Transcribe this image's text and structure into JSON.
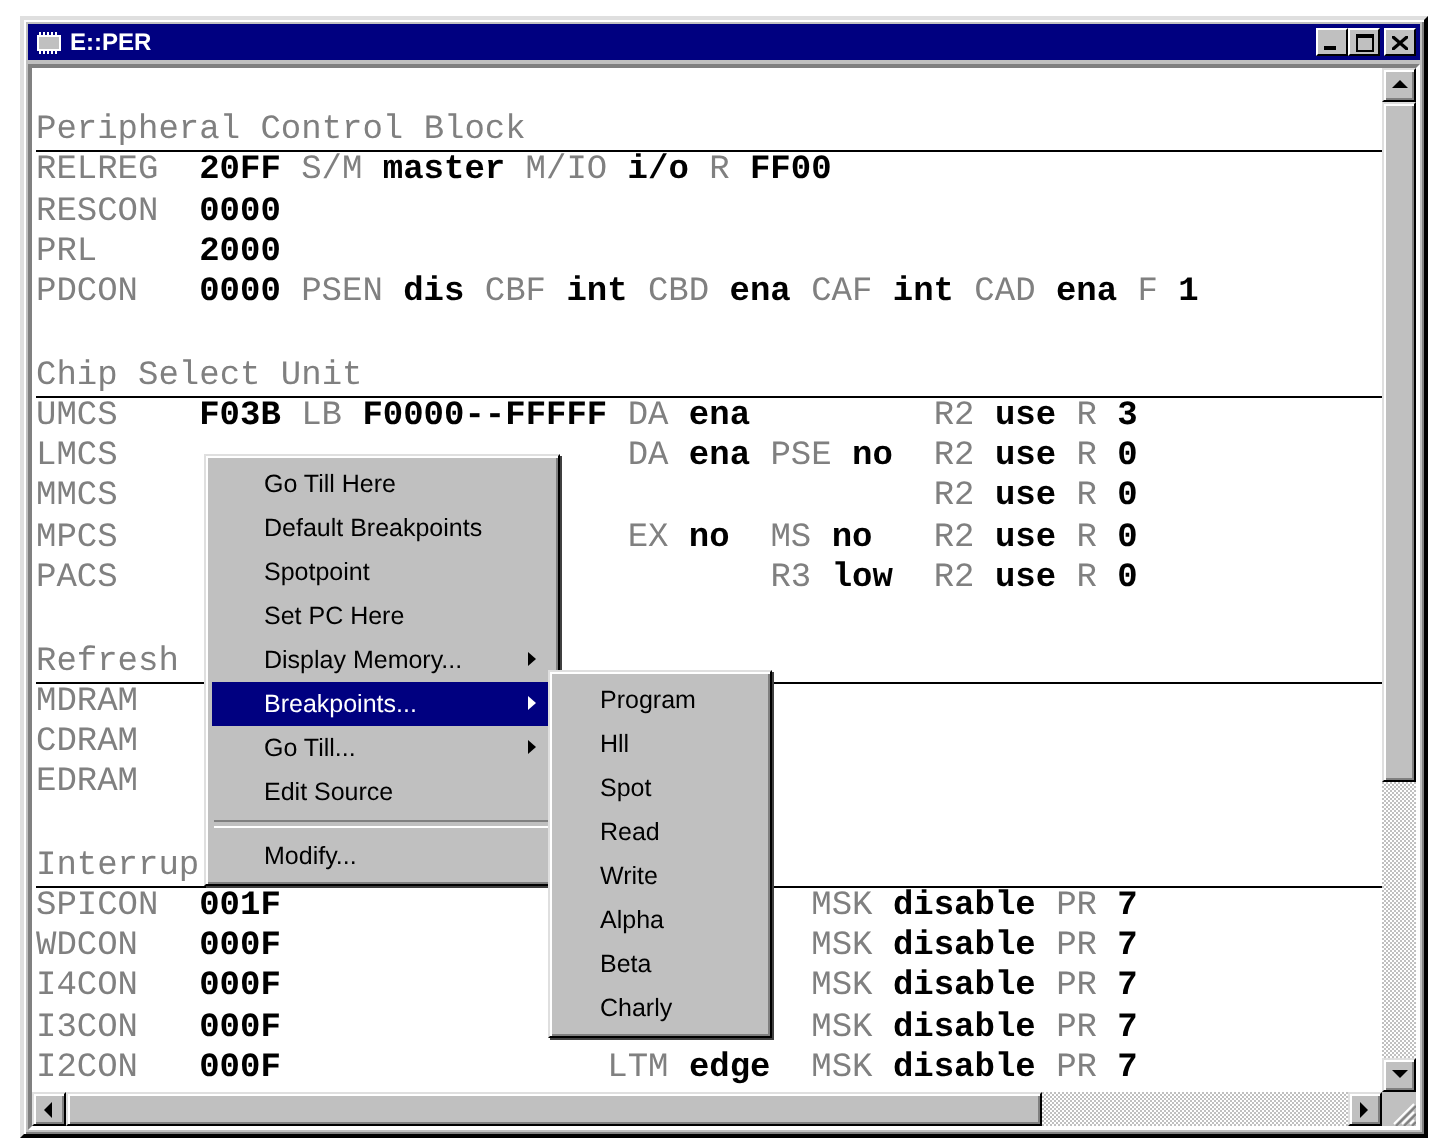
{
  "window": {
    "title": "E::PER"
  },
  "sections": [
    {
      "heading": "Peripheral Control Block",
      "kind": "flow",
      "rows": [
        {
          "name": "RELREG",
          "cells": [
            {
              "value": "20FF"
            },
            {
              "label": "S/M",
              "value": "master"
            },
            {
              "label": "M/IO",
              "value": "i/o"
            },
            {
              "label": "R",
              "value": "FF00"
            }
          ]
        },
        {
          "name": "RESCON",
          "cells": [
            {
              "value": "0000"
            }
          ]
        },
        {
          "name": "PRL",
          "cells": [
            {
              "value": "2000"
            }
          ]
        },
        {
          "name": "PDCON",
          "cells": [
            {
              "value": "0000"
            },
            {
              "label": "PSEN",
              "value": "dis"
            },
            {
              "label": "CBF",
              "value": "int"
            },
            {
              "label": "CBD",
              "value": "ena"
            },
            {
              "label": "CAF",
              "value": "int"
            },
            {
              "label": "CAD",
              "value": "ena"
            },
            {
              "label": "F",
              "value": "1"
            }
          ]
        }
      ]
    },
    {
      "heading": "Chip Select Unit",
      "kind": "columns",
      "rows": [
        {
          "name": "UMCS",
          "cells": [
            {
              "value": "F03B"
            },
            {
              "label": "LB",
              "value": "F0000--FFFFF"
            },
            {
              "label": "DA",
              "value": "ena"
            },
            null,
            {
              "label": "R2",
              "value": "use"
            },
            {
              "label": "R",
              "value": "3"
            }
          ]
        },
        {
          "name": "LMCS",
          "cells": [
            null,
            null,
            {
              "label": "DA",
              "value": "ena"
            },
            {
              "label": "PSE",
              "value": "no"
            },
            {
              "label": "R2",
              "value": "use"
            },
            {
              "label": "R",
              "value": "0"
            }
          ]
        },
        {
          "name": "MMCS",
          "cells": [
            null,
            null,
            null,
            null,
            {
              "label": "R2",
              "value": "use"
            },
            {
              "label": "R",
              "value": "0"
            }
          ]
        },
        {
          "name": "MPCS",
          "cells": [
            null,
            null,
            {
              "label": "EX",
              "value": "no"
            },
            {
              "label": "MS",
              "value": "no"
            },
            {
              "label": "R2",
              "value": "use"
            },
            {
              "label": "R",
              "value": "0"
            }
          ]
        },
        {
          "name": "PACS",
          "cells": [
            null,
            null,
            null,
            {
              "label": "R3",
              "value": "low"
            },
            {
              "label": "R2",
              "value": "use"
            },
            {
              "label": "R",
              "value": "0"
            }
          ]
        }
      ]
    },
    {
      "heading": "Refresh",
      "kind": "columns",
      "rows": [
        {
          "name": "MDRAM",
          "cells": []
        },
        {
          "name": "CDRAM",
          "cells": []
        },
        {
          "name": "EDRAM",
          "cells": []
        }
      ]
    },
    {
      "heading": "Interrup",
      "kind": "table",
      "rows": [
        {
          "name": "SPICON",
          "cells": [
            {
              "value": "001F"
            },
            null,
            {
              "label": "MSK",
              "value": "disable"
            },
            {
              "label": "PR",
              "value": "7"
            }
          ]
        },
        {
          "name": "WDCON",
          "cells": [
            {
              "value": "000F"
            },
            null,
            {
              "label": "MSK",
              "value": "disable"
            },
            {
              "label": "PR",
              "value": "7"
            }
          ]
        },
        {
          "name": "I4CON",
          "cells": [
            {
              "value": "000F"
            },
            null,
            {
              "label": "MSK",
              "value": "disable"
            },
            {
              "label": "PR",
              "value": "7"
            }
          ]
        },
        {
          "name": "I3CON",
          "cells": [
            {
              "value": "000F"
            },
            null,
            {
              "label": "MSK",
              "value": "disable"
            },
            {
              "label": "PR",
              "value": "7"
            }
          ]
        },
        {
          "name": "I2CON",
          "cells": [
            {
              "value": "000F"
            },
            {
              "label": "LTM",
              "value": "edge"
            },
            {
              "label": "MSK",
              "value": "disable"
            },
            {
              "label": "PR",
              "value": "7"
            }
          ]
        }
      ]
    }
  ],
  "context_menu": {
    "items": [
      {
        "kind": "command",
        "label": "Go Till Here",
        "selected": false
      },
      {
        "kind": "command",
        "label": "Default Breakpoints",
        "selected": false
      },
      {
        "kind": "command",
        "label": "Spotpoint",
        "selected": false
      },
      {
        "kind": "command",
        "label": "Set PC Here",
        "selected": false
      },
      {
        "kind": "submenu",
        "label": "Display Memory...",
        "selected": false
      },
      {
        "kind": "submenu",
        "label": "Breakpoints...",
        "selected": true
      },
      {
        "kind": "submenu",
        "label": "Go Till...",
        "selected": false
      },
      {
        "kind": "command",
        "label": "Edit Source",
        "selected": false
      },
      {
        "kind": "separator"
      },
      {
        "kind": "command",
        "label": "Modify...",
        "selected": false
      }
    ]
  },
  "submenu": {
    "items": [
      {
        "kind": "command",
        "label": "Program",
        "selected": false
      },
      {
        "kind": "command",
        "label": "Hll",
        "selected": false
      },
      {
        "kind": "command",
        "label": "Spot",
        "selected": false
      },
      {
        "kind": "command",
        "label": "Read",
        "selected": false
      },
      {
        "kind": "command",
        "label": "Write",
        "selected": false
      },
      {
        "kind": "command",
        "label": "Alpha",
        "selected": false
      },
      {
        "kind": "command",
        "label": "Beta",
        "selected": false
      },
      {
        "kind": "command",
        "label": "Charly",
        "selected": false
      }
    ]
  }
}
